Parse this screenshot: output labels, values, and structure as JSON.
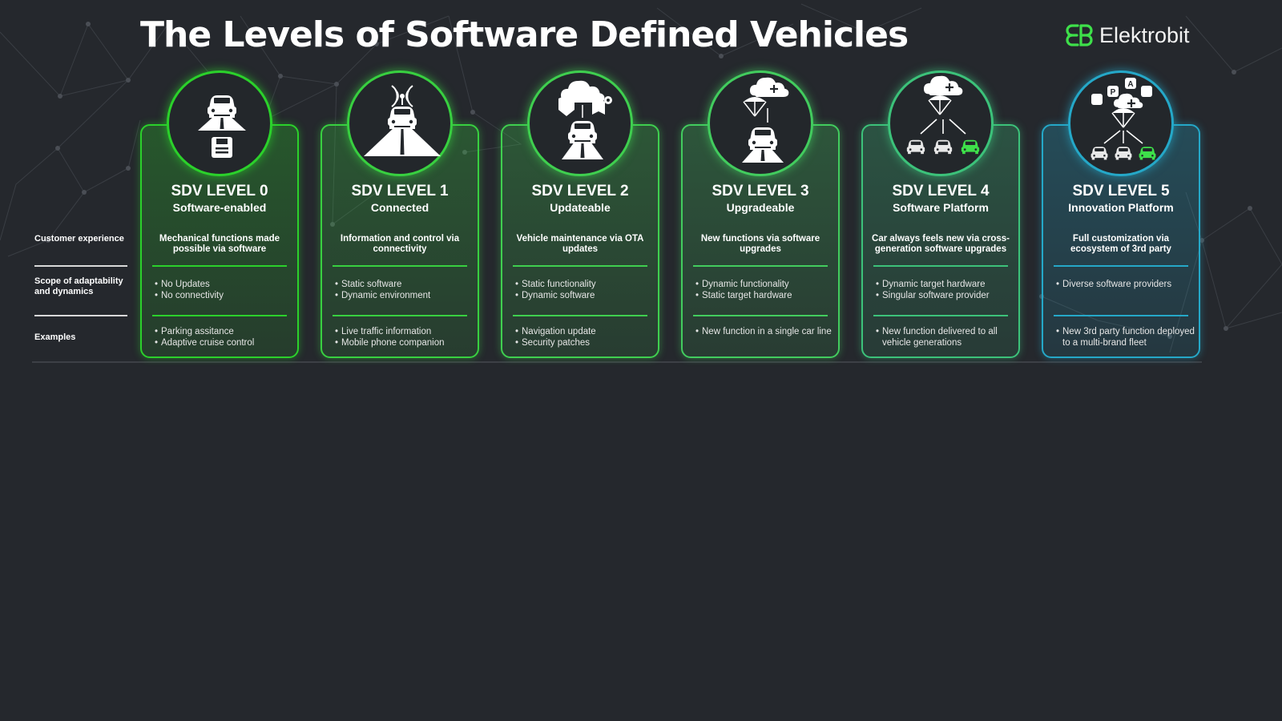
{
  "title": "The Levels of Software Defined Vehicles",
  "brand": {
    "name": "Elektrobit",
    "logo_icon": "elektrobit-logo-icon",
    "color": "#3ee04a"
  },
  "row_labels": {
    "customer_experience": "Customer experience",
    "scope": "Scope of adaptability and dynamics",
    "examples": "Examples"
  },
  "levels": [
    {
      "title": "SDV LEVEL 0",
      "subtitle": "Software-enabled",
      "icon": "car-on-road-with-floppy-disk-icon",
      "color": "#2bd12b",
      "customer_experience": "Mechanical functions made possible via software",
      "scope": [
        "No Updates",
        "No connectivity"
      ],
      "examples": [
        "Parking assitance",
        "Adaptive cruise control"
      ]
    },
    {
      "title": "SDV LEVEL 1",
      "subtitle": "Connected",
      "icon": "connected-car-antenna-icon",
      "color": "#38d040",
      "customer_experience": "Information and control via connectivity",
      "scope": [
        "Static software",
        "Dynamic environment"
      ],
      "examples": [
        "Live traffic information",
        "Mobile phone companion"
      ]
    },
    {
      "title": "SDV LEVEL 2",
      "subtitle": "Updateable",
      "icon": "cloud-update-car-icon",
      "color": "#3fcf4f",
      "customer_experience": "Vehicle maintenance via OTA updates",
      "scope": [
        "Static functionality",
        "Dynamic software"
      ],
      "examples": [
        "Navigation update",
        "Security patches"
      ]
    },
    {
      "title": "SDV LEVEL 3",
      "subtitle": "Upgradeable",
      "icon": "cloud-upgrade-car-icon",
      "color": "#42cc5e",
      "customer_experience": "New functions via software upgrades",
      "scope": [
        "Dynamic functionality",
        "Static target hardware"
      ],
      "examples": [
        "New function in a single car line"
      ]
    },
    {
      "title": "SDV LEVEL 4",
      "subtitle": "Software Platform",
      "icon": "cloud-platform-multi-car-icon",
      "color": "#3cc27a",
      "customer_experience": "Car always feels new via cross-generation software upgrades",
      "scope": [
        "Dynamic target hardware",
        "Singular software provider"
      ],
      "examples": [
        "New function delivered to all vehicle generations"
      ]
    },
    {
      "title": "SDV LEVEL 5",
      "subtitle": "Innovation Platform",
      "icon": "cloud-ecosystem-apps-multi-car-icon",
      "color": "#25a8c8",
      "customer_experience": "Full customization via ecosystem of 3rd party",
      "scope": [
        "Diverse software providers"
      ],
      "examples": [
        "New 3rd party function deployed to a multi-brand fleet"
      ]
    }
  ]
}
